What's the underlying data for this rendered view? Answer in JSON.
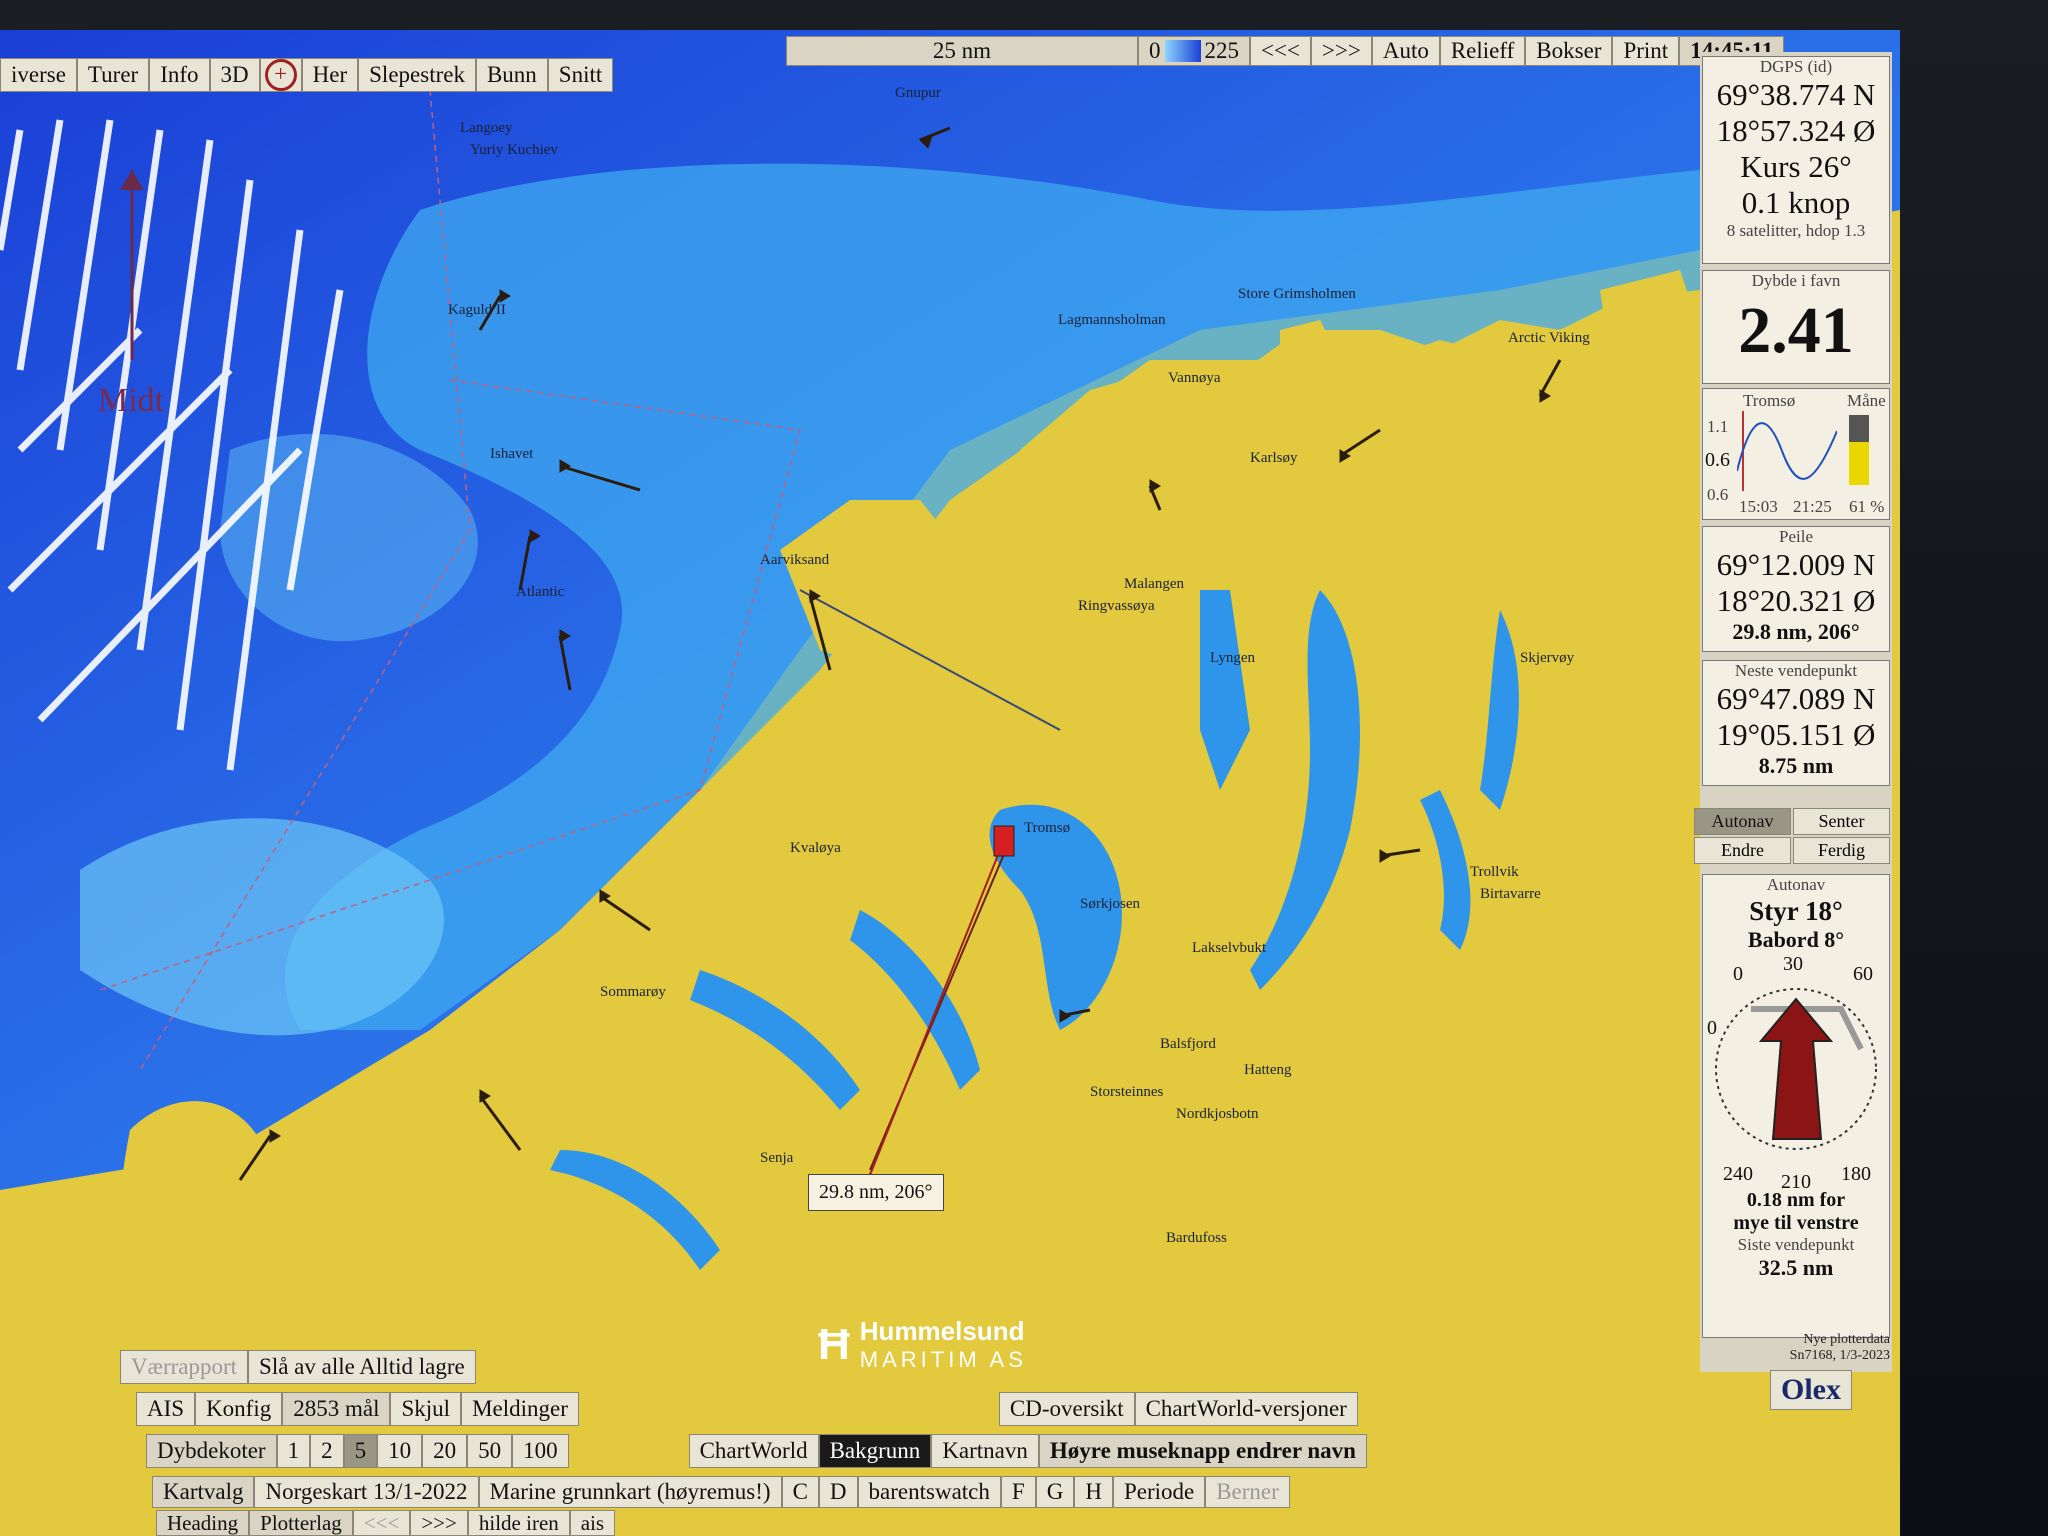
{
  "top_menu": {
    "items": [
      "iverse",
      "Turer",
      "Info",
      "3D",
      "Her",
      "Slepestrek",
      "Bunn",
      "Snitt"
    ]
  },
  "scale_bar": {
    "label": "25 nm"
  },
  "depth_legend": {
    "min": "0",
    "max": "225"
  },
  "top_right": {
    "prev": "<<<",
    "next": ">>>",
    "auto": "Auto",
    "relieff": "Relieff",
    "bokser": "Bokser",
    "print": "Print",
    "time": "14:45:11"
  },
  "gps": {
    "title": "DGPS (id)",
    "lat": "69°38.774 N",
    "lon": "18°57.324 Ø",
    "course": "Kurs 26°",
    "speed": "0.1 knop",
    "sats": "8 satelitter, hdop 1.3"
  },
  "depth": {
    "title": "Dybde i favn",
    "value": "2.41"
  },
  "tide": {
    "place": "Tromsø",
    "moon": "Måne",
    "y1": "1.1",
    "y2": "0.6",
    "y3": "0.6",
    "t1": "15:03",
    "t2": "21:25",
    "moon_pct": "61 %"
  },
  "bearing": {
    "title": "Peile",
    "lat": "69°12.009 N",
    "lon": "18°20.321 Ø",
    "dist": "29.8 nm, 206°"
  },
  "next_wp": {
    "title": "Neste vendepunkt",
    "lat": "69°47.089 N",
    "lon": "19°05.151 Ø",
    "dist": "8.75 nm"
  },
  "autonav_buttons": {
    "autonav": "Autonav",
    "senter": "Senter",
    "endre": "Endre",
    "ferdig": "Ferdig"
  },
  "steering": {
    "title": "Autonav",
    "styr": "Styr 18°",
    "babord": "Babord 8°",
    "a30": "30",
    "a0": "0",
    "a60": "60",
    "a0l": "0",
    "a240": "240",
    "a210": "210",
    "a180": "180",
    "msg1": "0.18 nm for",
    "msg2": "mye til venstre",
    "last_title": "Siste vendepunkt",
    "last": "32.5 nm"
  },
  "plotter_info": {
    "line1": "Nye plotterdata",
    "line2": "Sn7168, 1/3-2023"
  },
  "brand": "Olex",
  "midt": "Midt",
  "peil_tag": "29.8 nm, 206°",
  "logo": {
    "name": "Hummelsund",
    "sub": "MARITIM AS"
  },
  "bottom": {
    "row1": {
      "ais": "AIS",
      "konfig": "Konfig",
      "mal": "2853 mål",
      "skjul": "Skjul",
      "meldinger": "Meldinger",
      "vaer": "Værrapport",
      "slaa": "Slå av alle Alltid lagre"
    },
    "row2": {
      "cd": "CD-oversikt",
      "cw": "ChartWorld-versjoner"
    },
    "row3": {
      "dybde": "Dybdekoter",
      "levels": [
        "1",
        "2",
        "5",
        "10",
        "20",
        "50",
        "100"
      ],
      "chartworld": "ChartWorld",
      "bakgrunn": "Bakgrunn",
      "kartnavn": "Kartnavn",
      "hint": "Høyre museknapp endrer navn"
    },
    "row4": {
      "f": "F",
      "g": "G",
      "h": "H",
      "periode": "Periode",
      "berner": "Berner"
    },
    "row5": {
      "kartvalg": "Kartvalg",
      "norge": "Norgeskart 13/1-2022",
      "marine": "Marine grunnkart (høyremus!)",
      "c": "C",
      "d": "D",
      "barents": "barentswatch"
    },
    "row6": {
      "heading": "Heading",
      "plotterlag": "Plotterlag",
      "prev": "<<<",
      "next": ">>>",
      "hilde": "hilde iren",
      "ais": "ais"
    }
  },
  "map_labels": [
    {
      "t": "Gnupur"
    },
    {
      "t": "Langoey"
    },
    {
      "t": "Yuriy Kuchiev"
    },
    {
      "t": "Kaguld II"
    },
    {
      "t": "Ishavet"
    },
    {
      "t": "Atlantic"
    },
    {
      "t": "Aarviksand"
    },
    {
      "t": "Store Grimsholmen"
    },
    {
      "t": "Lagmannsholman"
    },
    {
      "t": "Arctic Viking"
    },
    {
      "t": "Vannøya"
    },
    {
      "t": "Karlsøy"
    },
    {
      "t": "Ringvassøya"
    },
    {
      "t": "Lyngen"
    },
    {
      "t": "Storsteinnes"
    },
    {
      "t": "Balsfjord"
    },
    {
      "t": "Sørkjosen"
    },
    {
      "t": "Lakselvbukt"
    },
    {
      "t": "Kvaløya"
    },
    {
      "t": "Tromsø"
    },
    {
      "t": "Malangen"
    },
    {
      "t": "Senja"
    },
    {
      "t": "Skjervøy"
    },
    {
      "t": "Birtavarre"
    },
    {
      "t": "Trollvik"
    },
    {
      "t": "Hatteng"
    },
    {
      "t": "Nordkjosbotn"
    },
    {
      "t": "Bardufoss"
    },
    {
      "t": "Sommarøy"
    }
  ]
}
